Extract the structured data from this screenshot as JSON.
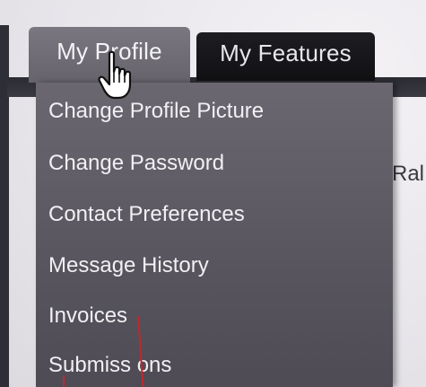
{
  "tabs": {
    "profile": "My Profile",
    "features": "My Features"
  },
  "menu": [
    "Change Profile Picture",
    "Change Password",
    "Contact Preferences",
    "Message History",
    "Invoices",
    "Submiss ons"
  ],
  "page": {
    "partial_text": "Ral"
  },
  "colors": {
    "active_tab": "#6e6b73",
    "inactive_tab": "#16161a",
    "menu_bg": "#5f5c66",
    "annotation": "#c0282e"
  }
}
